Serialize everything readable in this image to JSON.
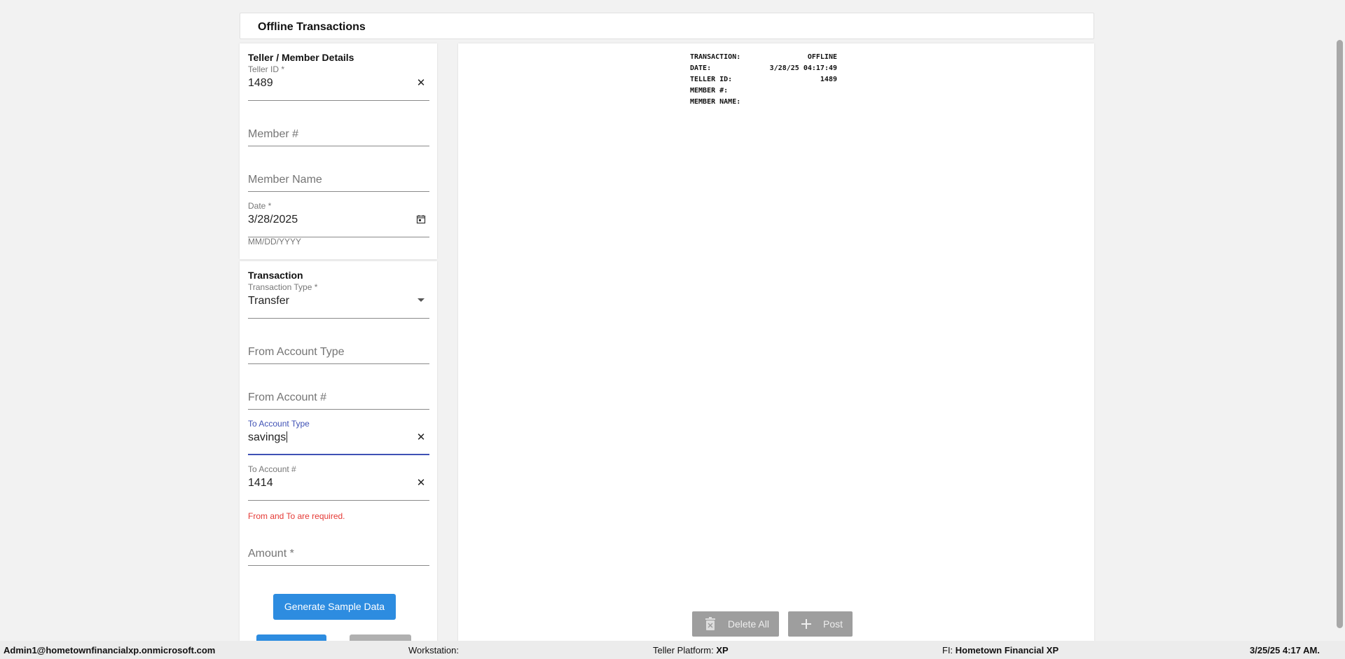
{
  "header": {
    "title": "Offline Transactions"
  },
  "teller_section": {
    "title": "Teller / Member Details",
    "teller_id": {
      "label": "Teller ID *",
      "value": "1489",
      "clear_icon": "close-icon"
    },
    "member_number": {
      "placeholder": "Member #"
    },
    "member_name": {
      "placeholder": "Member Name"
    },
    "date": {
      "label": "Date *",
      "value": "3/28/2025",
      "helper": "MM/DD/YYYY",
      "icon": "calendar-icon"
    }
  },
  "transaction_section": {
    "title": "Transaction",
    "transaction_type": {
      "label": "Transaction Type *",
      "value": "Transfer",
      "icon": "dropdown-arrow-icon"
    },
    "from_account_type": {
      "placeholder": "From Account Type"
    },
    "from_account_number": {
      "placeholder": "From Account #"
    },
    "to_account_type": {
      "label": "To Account Type",
      "value": "savings"
    },
    "to_account_number": {
      "label": "To Account #",
      "value": "1414"
    },
    "error": "From and To are required.",
    "amount": {
      "placeholder": "Amount *"
    },
    "generate_button": "Generate Sample Data"
  },
  "receipt": {
    "rows": [
      {
        "label": "TRANSACTION:",
        "value": "OFFLINE"
      },
      {
        "label": "DATE:",
        "value": "3/28/25 04:17:49"
      },
      {
        "label": "TELLER ID:",
        "value": "1489"
      },
      {
        "label": "MEMBER #:",
        "value": ""
      },
      {
        "label": "MEMBER NAME:",
        "value": ""
      }
    ],
    "delete_all_label": "Delete All",
    "post_label": "Post"
  },
  "status_bar": {
    "user": "Admin1@hometownfinancialxp.onmicrosoft.com",
    "workstation_label": "Workstation:",
    "workstation_value": "",
    "platform_label": "Teller Platform:",
    "platform_value": "XP",
    "fi_label": "FI:",
    "fi_value": "Hometown Financial XP",
    "datetime": "3/25/25 4:17 AM."
  },
  "colors": {
    "primary": "#2d8ce0",
    "focus": "#3f51b5",
    "error": "#e53935",
    "disabled": "#9e9e9e"
  }
}
